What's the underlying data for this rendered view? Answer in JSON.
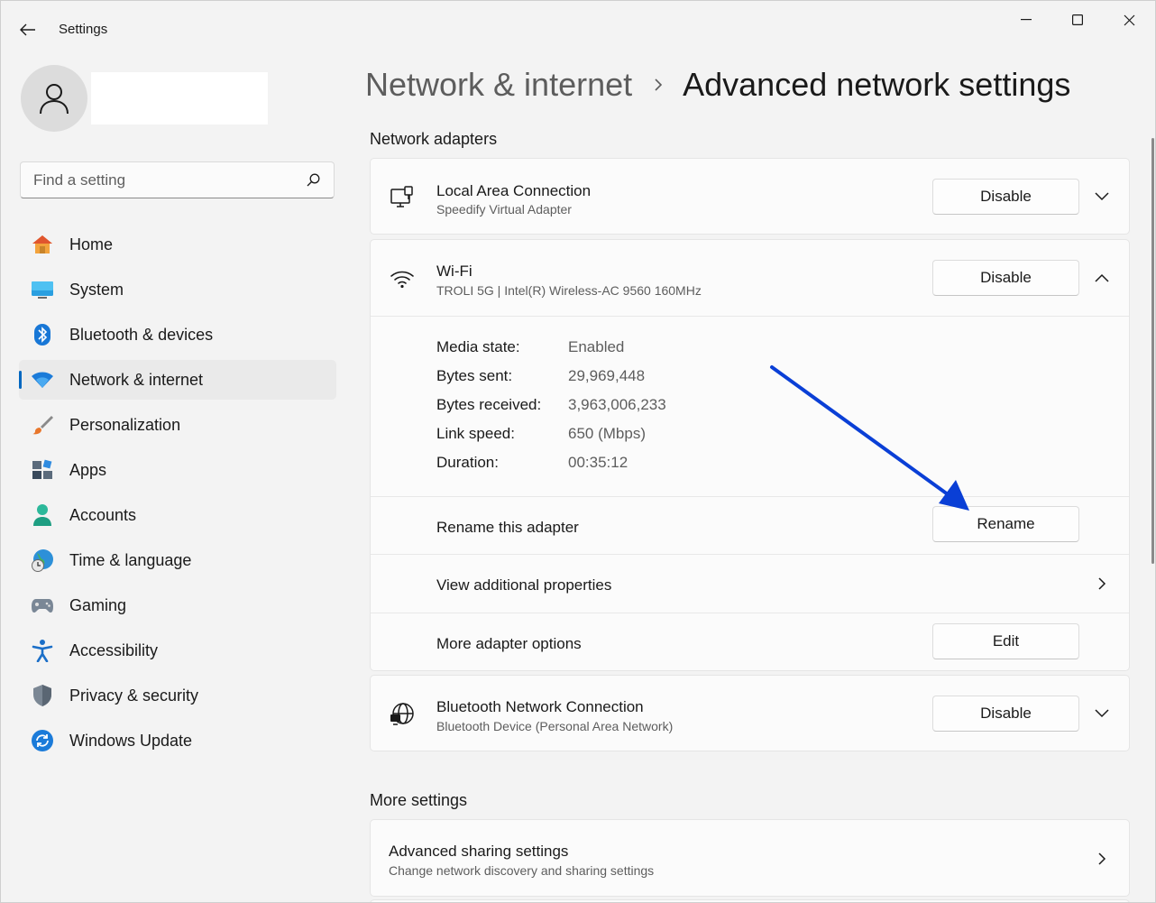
{
  "window": {
    "title": "Settings"
  },
  "sidebar": {
    "search_placeholder": "Find a setting",
    "items": [
      {
        "label": "Home",
        "icon": "home-icon"
      },
      {
        "label": "System",
        "icon": "system-icon"
      },
      {
        "label": "Bluetooth & devices",
        "icon": "bluetooth-icon"
      },
      {
        "label": "Network & internet",
        "icon": "wifi-icon",
        "active": true
      },
      {
        "label": "Personalization",
        "icon": "brush-icon"
      },
      {
        "label": "Apps",
        "icon": "apps-icon"
      },
      {
        "label": "Accounts",
        "icon": "accounts-icon"
      },
      {
        "label": "Time & language",
        "icon": "clock-globe-icon"
      },
      {
        "label": "Gaming",
        "icon": "gamepad-icon"
      },
      {
        "label": "Accessibility",
        "icon": "accessibility-icon"
      },
      {
        "label": "Privacy & security",
        "icon": "shield-icon"
      },
      {
        "label": "Windows Update",
        "icon": "update-icon"
      }
    ]
  },
  "breadcrumb": {
    "parent": "Network & internet",
    "current": "Advanced network settings"
  },
  "network_adapters": {
    "section_title": "Network adapters",
    "local": {
      "title": "Local Area Connection",
      "subtitle": "Speedify Virtual Adapter",
      "button": "Disable"
    },
    "wifi": {
      "title": "Wi-Fi",
      "subtitle": "TROLI 5G | Intel(R) Wireless-AC 9560 160MHz",
      "button": "Disable",
      "details": [
        {
          "label": "Media state:",
          "value": "Enabled"
        },
        {
          "label": "Bytes sent:",
          "value": "29,969,448"
        },
        {
          "label": "Bytes received:",
          "value": "3,963,006,233"
        },
        {
          "label": "Link speed:",
          "value": "650 (Mbps)"
        },
        {
          "label": "Duration:",
          "value": "00:35:12"
        }
      ],
      "rename_label": "Rename this adapter",
      "rename_button": "Rename",
      "view_props_label": "View additional properties",
      "more_options_label": "More adapter options",
      "edit_button": "Edit"
    },
    "bluetooth": {
      "title": "Bluetooth Network Connection",
      "subtitle": "Bluetooth Device (Personal Area Network)",
      "button": "Disable"
    }
  },
  "more_settings": {
    "section_title": "More settings",
    "sharing": {
      "title": "Advanced sharing settings",
      "subtitle": "Change network discovery and sharing settings"
    }
  },
  "colors": {
    "accent": "#0067c0",
    "annotation_arrow": "#0a3fd6"
  }
}
